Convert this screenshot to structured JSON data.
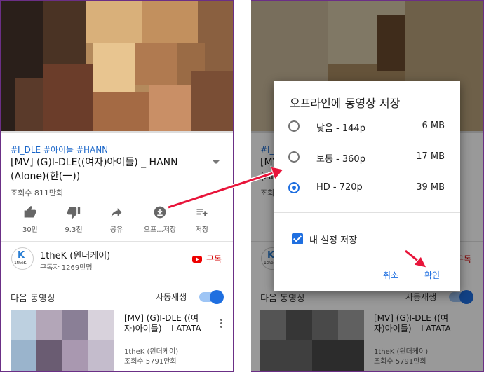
{
  "video": {
    "hashtags": "#I_DLE #아이들 #HANN",
    "title": "[MV] (G)I-DLE((여자)아이들) _ HANN (Alone)(한(一))",
    "views": "조회수 811만회"
  },
  "actions": [
    {
      "icon": "thumb-up-icon",
      "label": "30만"
    },
    {
      "icon": "thumb-down-icon",
      "label": "9.3천"
    },
    {
      "icon": "share-icon",
      "label": "공유"
    },
    {
      "icon": "download-icon",
      "label": "오프...저장"
    },
    {
      "icon": "playlist-add-icon",
      "label": "저장"
    }
  ],
  "channel": {
    "logo_text": "K",
    "logo_subtext": "1theK",
    "name": "1theK (원더케이)",
    "subscribers": "구독자 1269만명",
    "subscribe_label": "구독"
  },
  "up_next": {
    "label": "다음 동영상",
    "autoplay_label": "자동재생",
    "item": {
      "title": "[MV] (G)I-DLE ((여자)아이들) _ LATATA",
      "channel": "1theK (원더케이)",
      "views": "조회수 5791만회"
    }
  },
  "dialog": {
    "title": "오프라인에 동영상 저장",
    "options": [
      {
        "label": "낮음 - 144p",
        "size": "6 MB",
        "selected": false
      },
      {
        "label": "보통 - 360p",
        "size": "17 MB",
        "selected": false
      },
      {
        "label": "HD - 720p",
        "size": "39 MB",
        "selected": true
      }
    ],
    "remember_label": "내 설정 저장",
    "cancel_label": "취소",
    "ok_label": "확인"
  },
  "colors": {
    "accent": "#1f6fe0",
    "subscribe": "#d40000",
    "annotation_arrow": "#e8143a",
    "frame": "#6b2f86"
  }
}
